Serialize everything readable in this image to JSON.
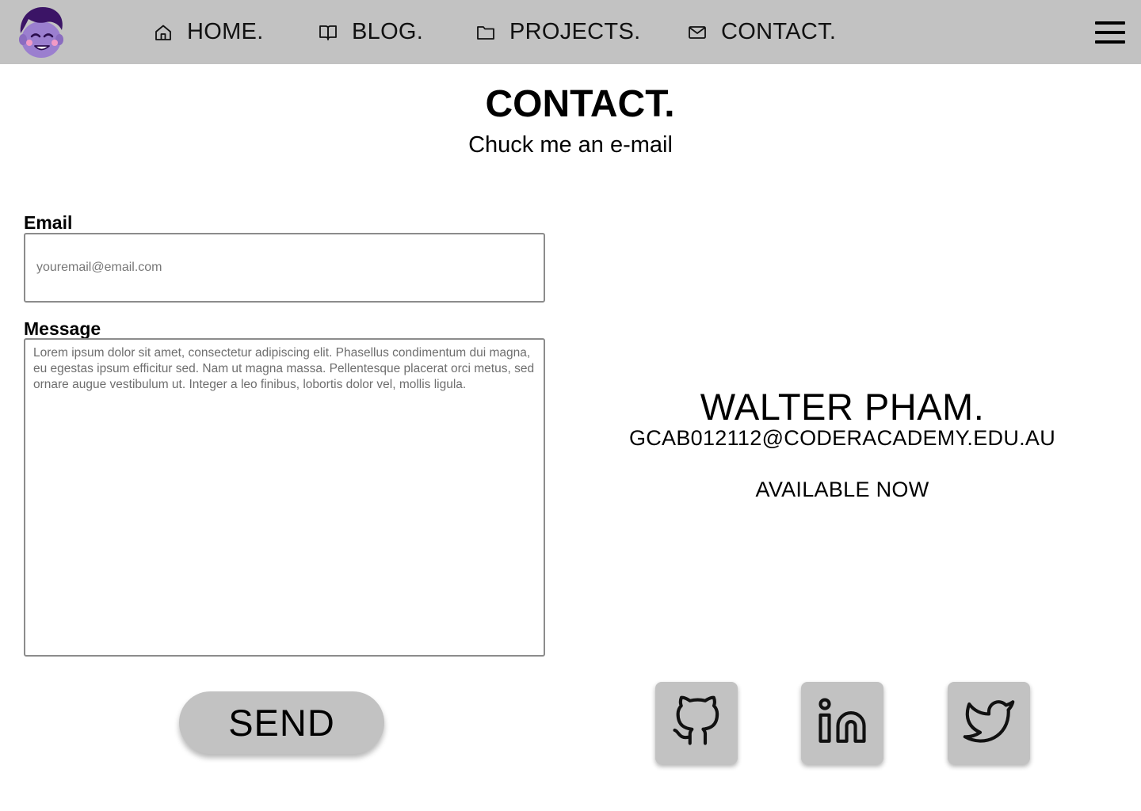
{
  "nav": {
    "items": [
      {
        "label": "HOME.",
        "icon": "home-icon"
      },
      {
        "label": "BLOG.",
        "icon": "book-icon"
      },
      {
        "label": "PROJECTS.",
        "icon": "folder-icon"
      },
      {
        "label": "CONTACT.",
        "icon": "mail-icon"
      }
    ],
    "menu_icon": "hamburger-menu-icon",
    "logo_icon": "avatar-logo"
  },
  "header": {
    "title": "CONTACT.",
    "subtitle": "Chuck me an e-mail"
  },
  "form": {
    "email_label": "Email",
    "email_placeholder": "youremail@email.com",
    "message_label": "Message",
    "message_placeholder": "Lorem ipsum dolor sit amet, consectetur adipiscing elit. Phasellus condimentum dui magna, eu egestas ipsum efficitur sed. Nam ut magna massa. Pellentesque placerat orci metus, sed ornare augue vestibulum ut. Integer a leo finibus, lobortis dolor vel, mollis ligula.",
    "send_label": "SEND"
  },
  "contact": {
    "name": "WALTER PHAM.",
    "email": "GCAB012112@CODERACADEMY.EDU.AU",
    "availability": "AVAILABLE NOW"
  },
  "social": [
    {
      "icon": "github-icon"
    },
    {
      "icon": "linkedin-icon"
    },
    {
      "icon": "twitter-icon"
    }
  ],
  "colors": {
    "navbar_bg": "#c2c2c2",
    "button_bg": "#c2c2c2",
    "avatar_purple": "#9b7fcf",
    "avatar_hair": "#3b1466"
  }
}
